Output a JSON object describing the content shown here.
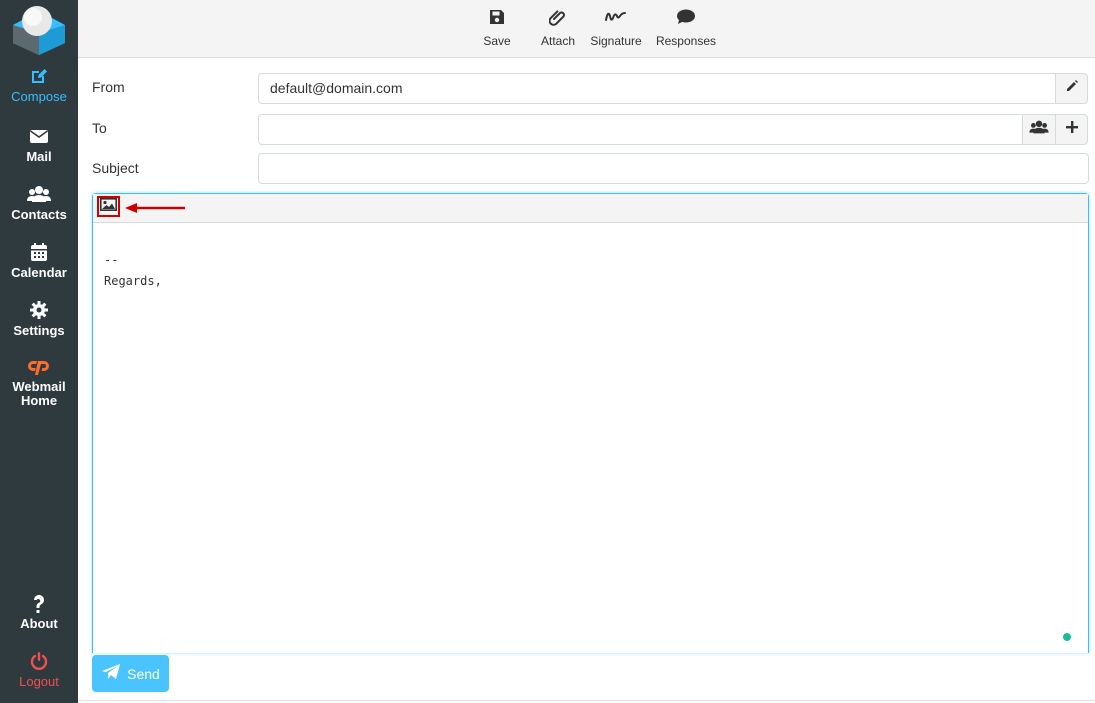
{
  "sidebar": {
    "items": [
      {
        "label": "Compose",
        "icon": "compose-icon"
      },
      {
        "label": "Mail",
        "icon": "envelope-icon"
      },
      {
        "label": "Contacts",
        "icon": "users-icon"
      },
      {
        "label": "Calendar",
        "icon": "calendar-icon"
      },
      {
        "label": "Settings",
        "icon": "gear-icon"
      },
      {
        "label_line1": "Webmail",
        "label_line2": "Home",
        "icon": "cpanel-icon"
      }
    ],
    "about_label": "About",
    "logout_label": "Logout"
  },
  "toolbar": {
    "save_label": "Save",
    "attach_label": "Attach",
    "signature_label": "Signature",
    "responses_label": "Responses"
  },
  "form": {
    "from_label": "From",
    "from_value": "default@domain.com",
    "to_label": "To",
    "to_value": "",
    "subject_label": "Subject",
    "subject_value": ""
  },
  "editor": {
    "signature_sep": "--",
    "signature_text": "Regards,"
  },
  "send_label": "Send",
  "colors": {
    "accent": "#37beff",
    "sidebar_bg": "#2f3a3f",
    "logout": "#f05050",
    "highlight": "#d00000",
    "status": "#1abc9c"
  }
}
